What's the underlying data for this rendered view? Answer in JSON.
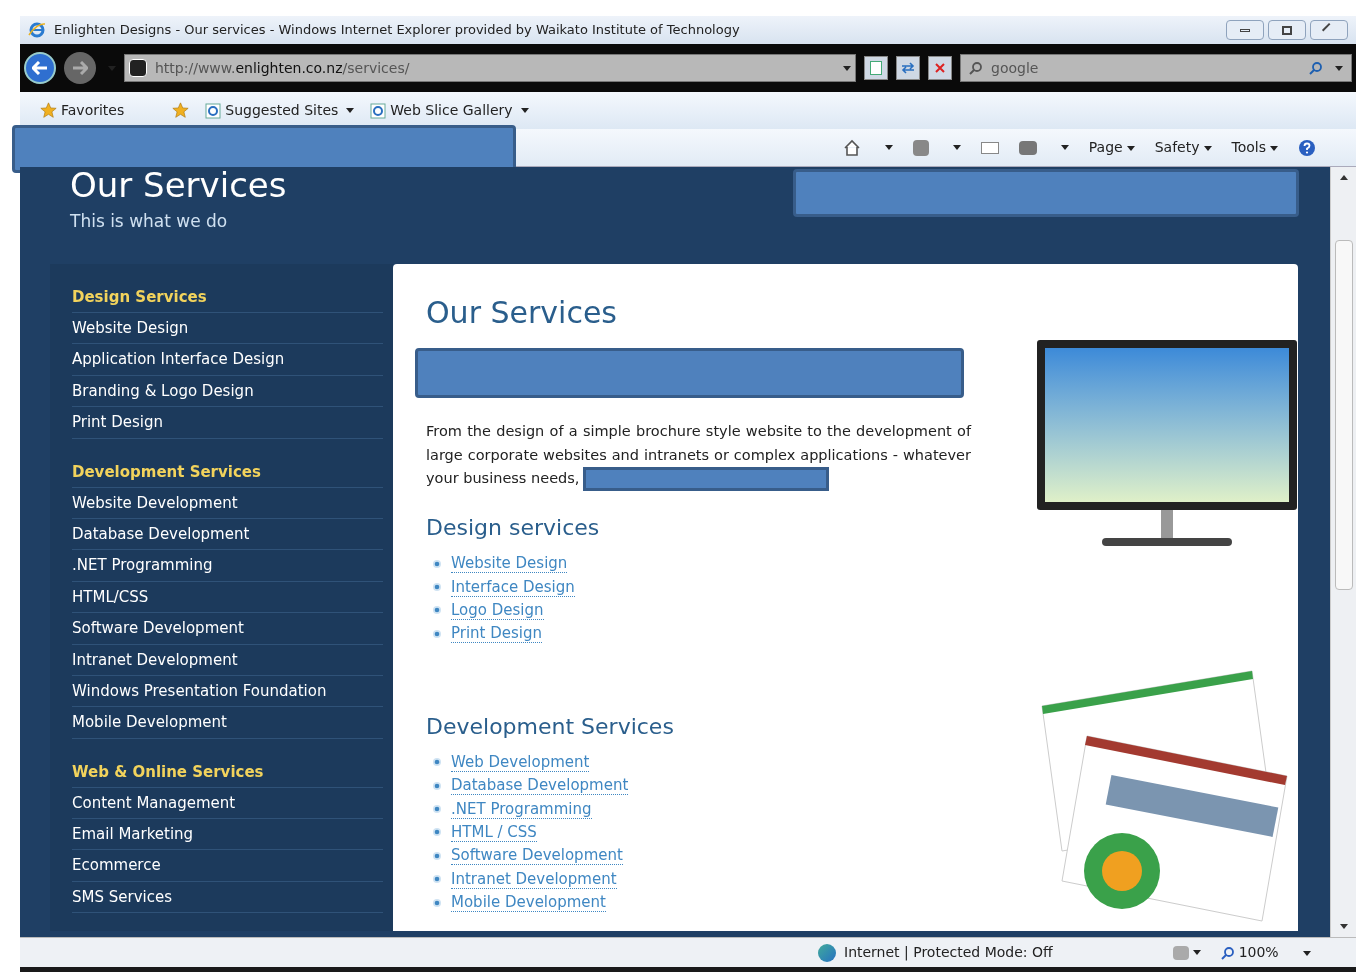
{
  "window": {
    "title": "Enlighten Designs - Our services - Windows Internet Explorer provided by Waikato Institute of Technology"
  },
  "address_bar": {
    "url_prefix": "http://www.",
    "url_domain": "enlighten.co.nz",
    "url_path": "/services/"
  },
  "search": {
    "placeholder": "google"
  },
  "favorites_bar": {
    "favorites": "Favorites",
    "links": [
      "Suggested Sites",
      "Web Slice Gallery"
    ]
  },
  "command_bar": {
    "menus": [
      "Page",
      "Safety",
      "Tools"
    ]
  },
  "page_header": {
    "title": "Our Services",
    "tagline": "This is what we do"
  },
  "sidebar": {
    "groups": [
      {
        "heading": "Design Services",
        "items": [
          "Website Design",
          "Application Interface Design",
          "Branding & Logo Design",
          "Print Design"
        ]
      },
      {
        "heading": "Development Services",
        "items": [
          "Website Development",
          "Database Development",
          ".NET Programming",
          "HTML/CSS",
          "Software Development",
          "Intranet Development",
          "Windows Presentation Foundation",
          "Mobile Development"
        ]
      },
      {
        "heading": "Web & Online Services",
        "items": [
          "Content Management",
          "Email Marketing",
          "Ecommerce",
          "SMS Services"
        ]
      }
    ]
  },
  "main": {
    "title": "Our Services",
    "intro": "From the design of a simple brochure style website to the development of large corporate websites and intranets or complex applications - whatever your business needs,",
    "sections": [
      {
        "heading": "Design services",
        "links": [
          "Website Design",
          "Interface Design",
          "Logo Design",
          "Print Design"
        ]
      },
      {
        "heading": "Development Services",
        "links": [
          "Web Development",
          "Database Development",
          ".NET Programming",
          "HTML / CSS",
          "Software Development",
          "Intranet Development",
          "Mobile Development"
        ]
      }
    ]
  },
  "status_bar": {
    "zone": "Internet | Protected Mode: Off",
    "zoom": "100%"
  }
}
